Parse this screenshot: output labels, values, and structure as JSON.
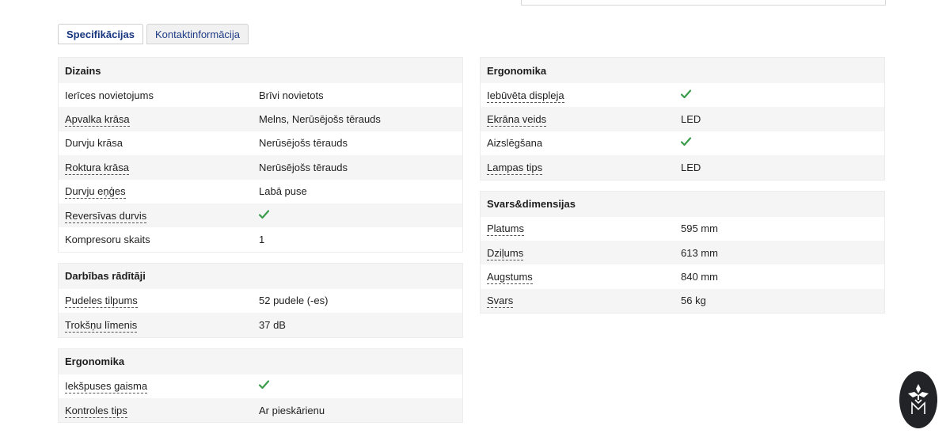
{
  "tabs": [
    {
      "label": "Specifikācijas",
      "active": true
    },
    {
      "label": "Kontaktinformācija",
      "active": false
    }
  ],
  "left": [
    {
      "title": "Dizains",
      "rows": [
        {
          "label": "Ierīces novietojums",
          "value": "Brīvi novietots",
          "dashed": false
        },
        {
          "label": "Apvalka krāsa",
          "value": "Melns, Nerūsējošs tērauds",
          "dashed": true
        },
        {
          "label": "Durvju krāsa",
          "value": "Nerūsējošs tērauds",
          "dashed": false
        },
        {
          "label": "Roktura krāsa",
          "value": "Nerūsējošs tērauds",
          "dashed": true
        },
        {
          "label": "Durvju eņģes",
          "value": "Labā puse",
          "dashed": true
        },
        {
          "label": "Reversīvas durvis",
          "value": "check",
          "dashed": true
        },
        {
          "label": "Kompresoru skaits",
          "value": "1",
          "dashed": false
        }
      ]
    },
    {
      "title": "Darbības rādītāji",
      "rows": [
        {
          "label": "Pudeles tilpums",
          "value": "52 pudele (-es)",
          "dashed": true
        },
        {
          "label": "Trokšņu līmenis",
          "value": "37 dB",
          "dashed": true
        }
      ]
    },
    {
      "title": "Ergonomika",
      "rows": [
        {
          "label": "Iekšpuses gaisma",
          "value": "check",
          "dashed": true
        },
        {
          "label": "Kontroles tips",
          "value": "Ar pieskārienu",
          "dashed": true
        }
      ]
    }
  ],
  "right": [
    {
      "title": "Ergonomika",
      "rows": [
        {
          "label": "Iebūvēta displeja",
          "value": "check",
          "dashed": true
        },
        {
          "label": "Ekrāna veids",
          "value": "LED",
          "dashed": true
        },
        {
          "label": "Aizslēgšana",
          "value": "check",
          "dashed": false
        },
        {
          "label": "Lampas tips",
          "value": "LED",
          "dashed": true
        }
      ]
    },
    {
      "title": "Svars&dimensijas",
      "rows": [
        {
          "label": "Platums",
          "value": "595 mm",
          "dashed": true
        },
        {
          "label": "Dziļums",
          "value": "613 mm",
          "dashed": true
        },
        {
          "label": "Augstums",
          "value": "840 mm",
          "dashed": true
        },
        {
          "label": "Svars",
          "value": "56 kg",
          "dashed": true
        }
      ]
    }
  ],
  "colors": {
    "check": "#3a9b4a",
    "tab_text": "#1e3b85",
    "badge": "#222326"
  },
  "icons": {
    "check": "check-icon",
    "badge": "brand-emblem-icon"
  }
}
